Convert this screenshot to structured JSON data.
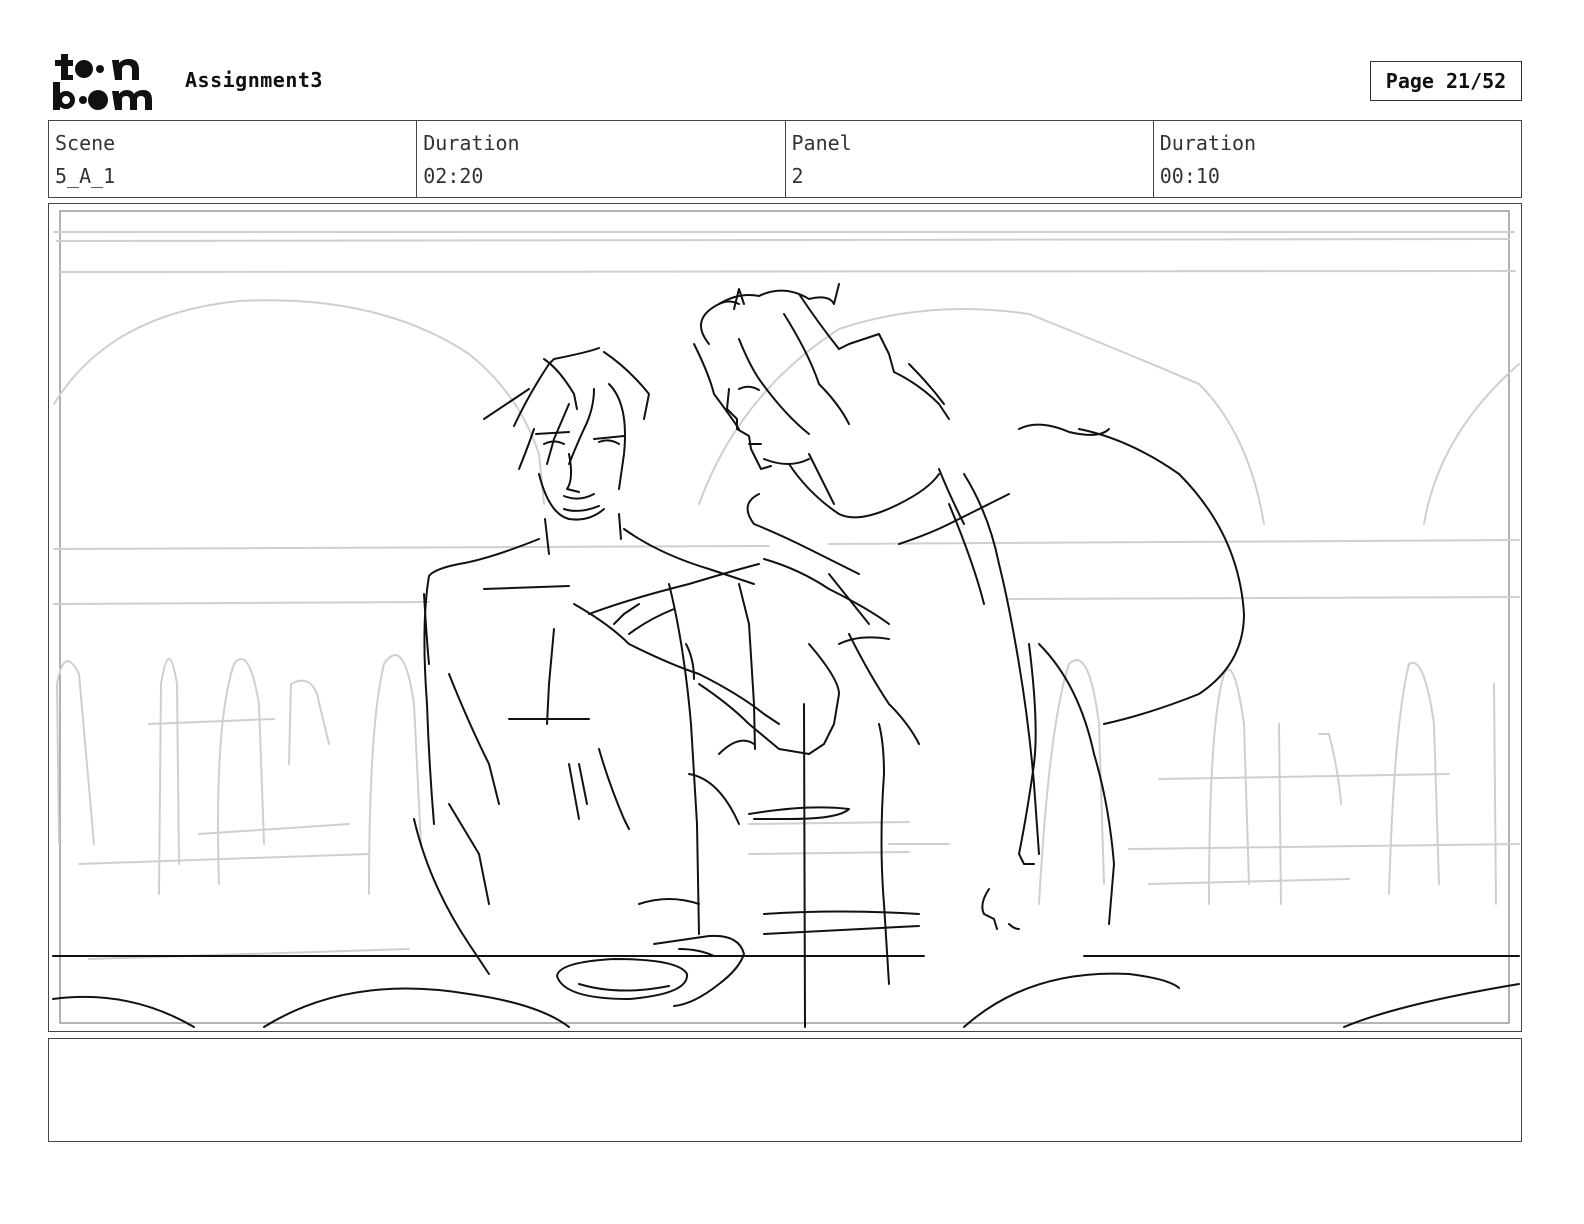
{
  "header": {
    "logo_text": "toon boom",
    "project_title": "Assignment3",
    "page_indicator": "Page 21/52"
  },
  "info": {
    "scene_label": "Scene",
    "scene_value": "5_A_1",
    "scene_duration_label": "Duration",
    "scene_duration_value": "02:20",
    "panel_label": "Panel",
    "panel_value": "2",
    "panel_duration_label": "Duration",
    "panel_duration_value": "00:10"
  },
  "notes": {
    "text": ""
  },
  "colors": {
    "sketch_main": "#111111",
    "sketch_background": "#c8c8c8",
    "border": "#444444"
  }
}
